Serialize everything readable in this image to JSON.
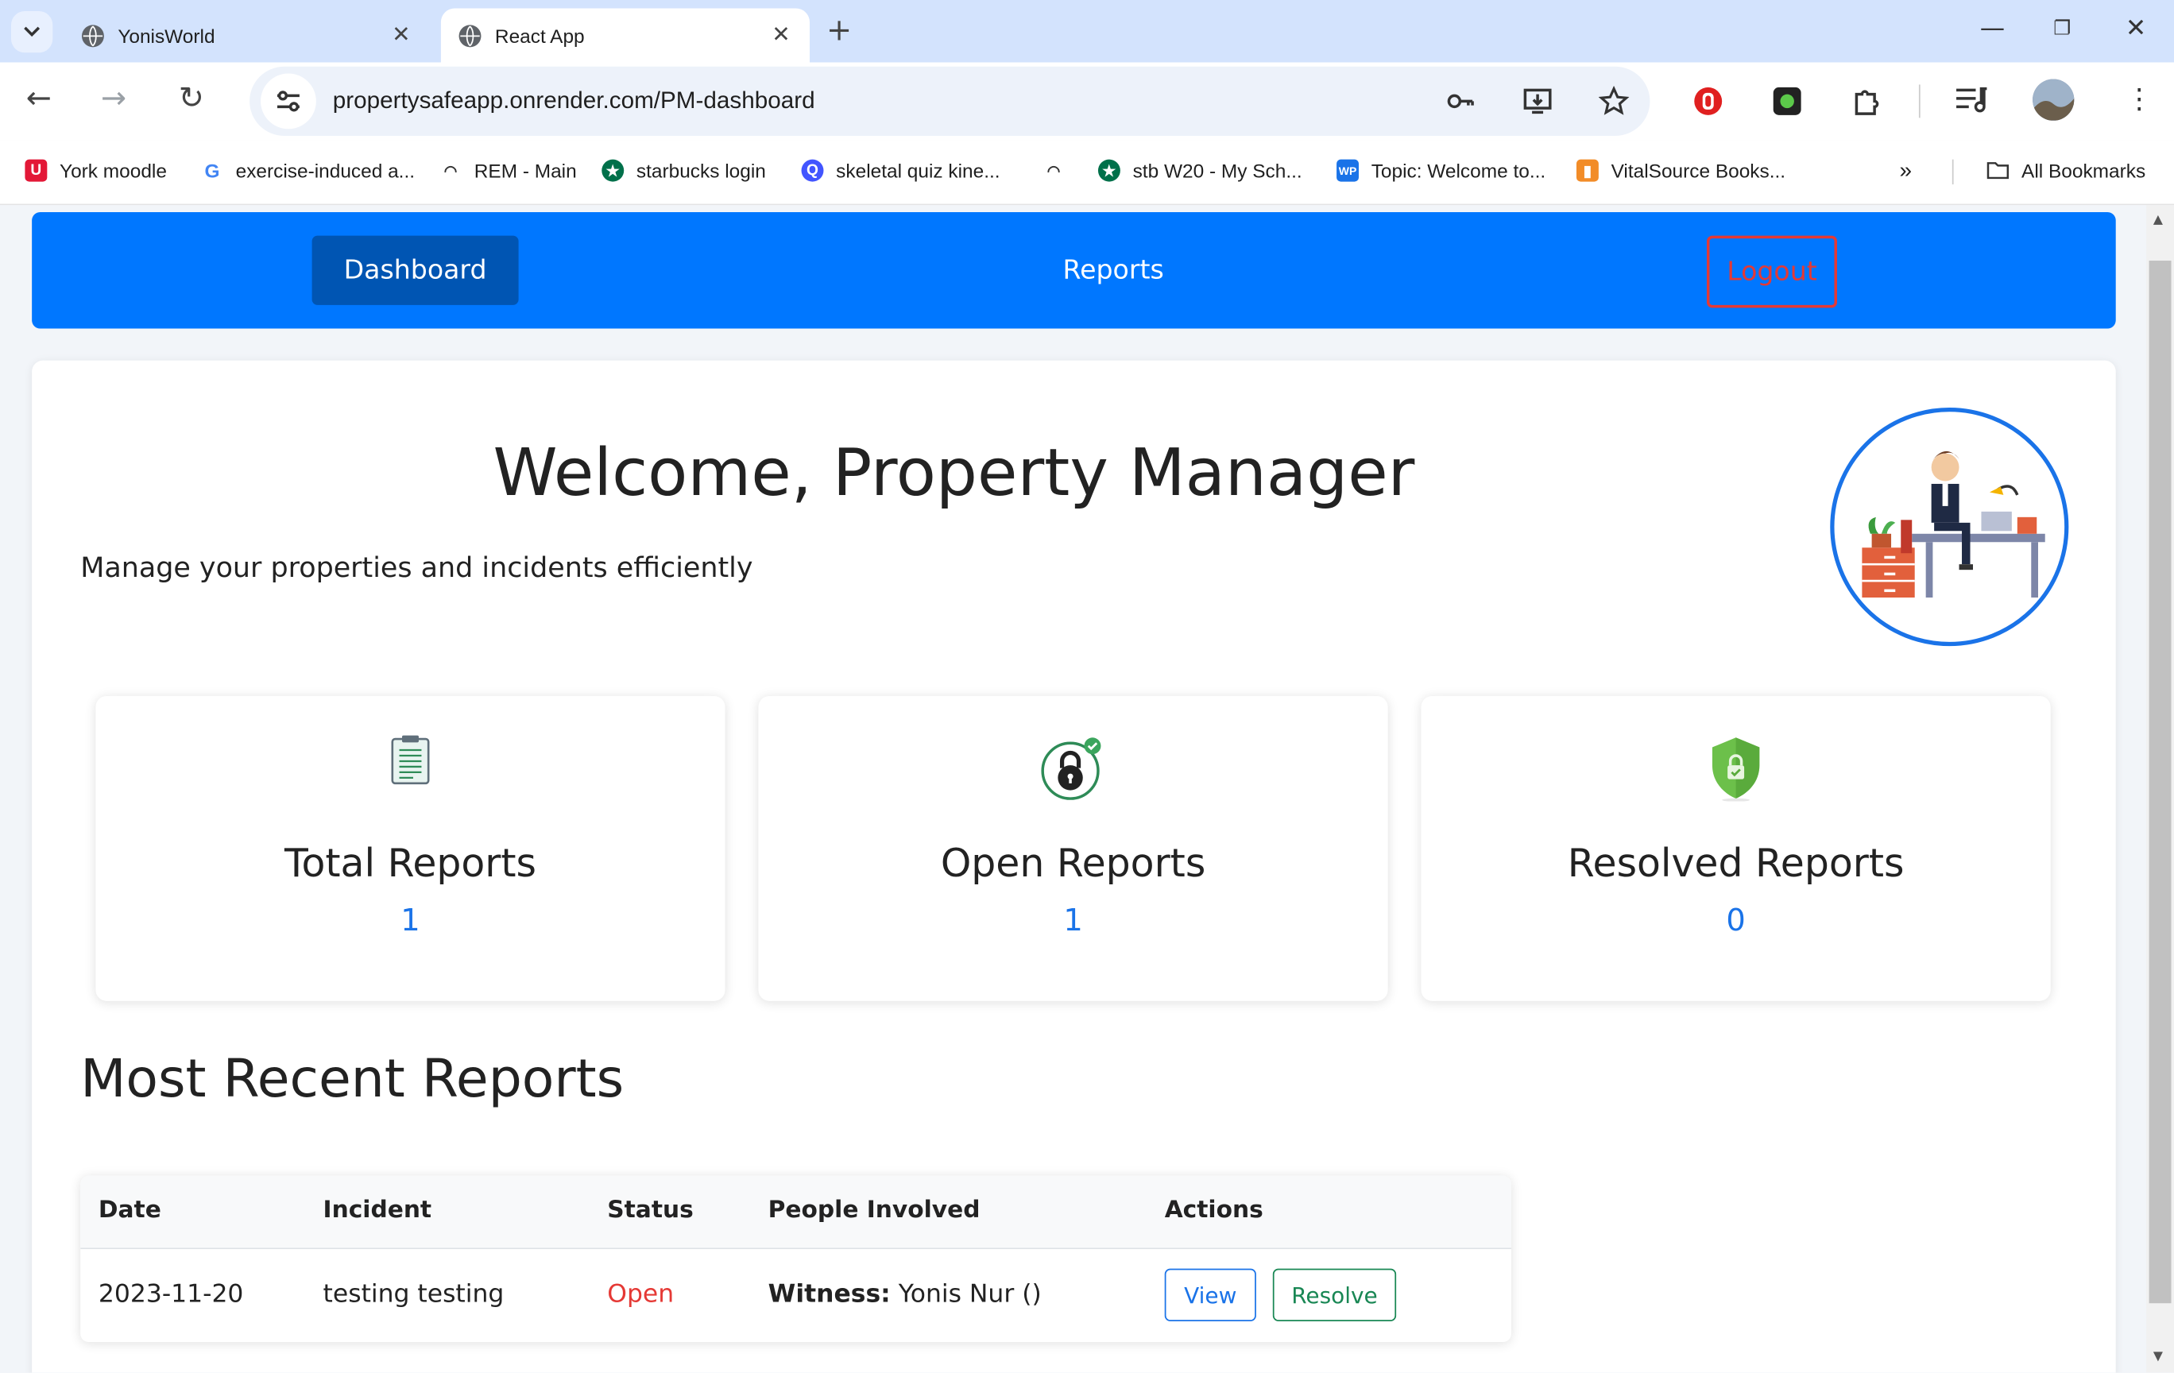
{
  "browser": {
    "tabs": [
      {
        "title": "YonisWorld",
        "active": false
      },
      {
        "title": "React App",
        "active": true
      }
    ],
    "url": "propertysafeapp.onrender.com/PM-dashboard",
    "bookmarks": [
      {
        "label": "York moodle"
      },
      {
        "label": "exercise-induced a..."
      },
      {
        "label": "REM - Main"
      },
      {
        "label": "starbucks login"
      },
      {
        "label": "skeletal quiz kine..."
      },
      {
        "label": ""
      },
      {
        "label": "stb W20 - My Sch..."
      },
      {
        "label": "Topic: Welcome to..."
      },
      {
        "label": "VitalSource Books..."
      }
    ],
    "all_bookmarks": "All Bookmarks"
  },
  "nav": {
    "dashboard": "Dashboard",
    "reports": "Reports",
    "logout": "Logout"
  },
  "header": {
    "title": "Welcome, Property Manager",
    "subtitle": "Manage your properties and incidents efficiently"
  },
  "stats": [
    {
      "label": "Total Reports",
      "value": "1",
      "icon": "clipboard-icon"
    },
    {
      "label": "Open Reports",
      "value": "1",
      "icon": "padlock-icon"
    },
    {
      "label": "Resolved Reports",
      "value": "0",
      "icon": "shield-icon"
    }
  ],
  "recent": {
    "title": "Most Recent Reports",
    "columns": [
      "Date",
      "Incident",
      "Status",
      "People Involved",
      "Actions"
    ],
    "rows": [
      {
        "date": "2023-11-20",
        "incident": "testing testing",
        "status": "Open",
        "people_role": "Witness:",
        "people_name": "Yonis Nur ()",
        "actions": [
          "View",
          "Resolve"
        ]
      }
    ]
  },
  "colors": {
    "nav_bg": "#0077ff",
    "active_nav": "#0055b3",
    "logout": "#e53935",
    "stat_value": "#1a73e8",
    "status_open": "#e53935",
    "resolve": "#198754"
  }
}
